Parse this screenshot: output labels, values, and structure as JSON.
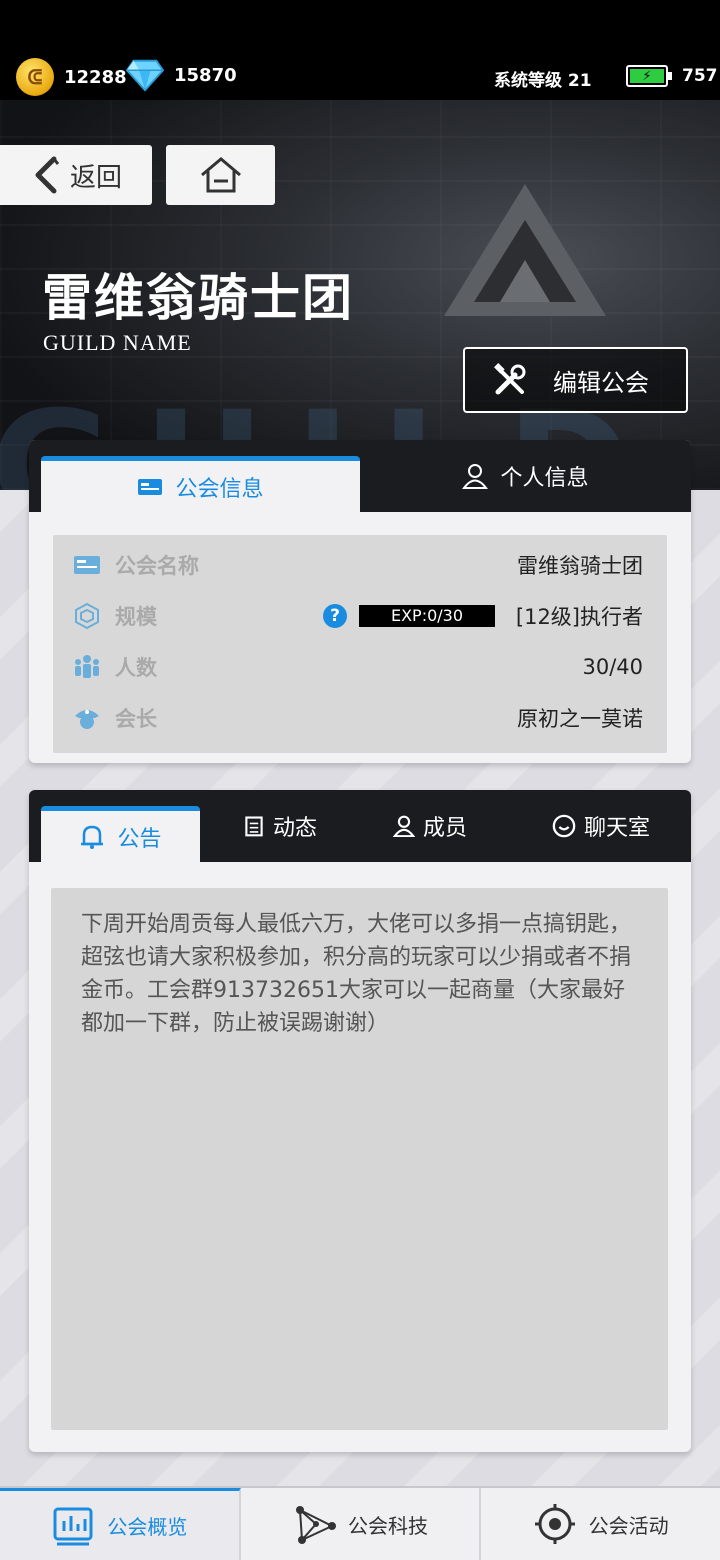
{
  "status_bar": {
    "coins": "12288",
    "gems": "15870",
    "system_level": "系统等级 21",
    "energy": "757"
  },
  "nav": {
    "back_label": "返回"
  },
  "guild": {
    "name": "雷维翁骑士团",
    "subtitle": "GUILD NAME",
    "edit_label": "编辑公会"
  },
  "info_card": {
    "tabs": [
      {
        "label": "公会信息",
        "icon": "id-card-icon"
      },
      {
        "label": "个人信息",
        "icon": "person-icon"
      }
    ],
    "rows": {
      "name": {
        "label": "公会名称",
        "value": "雷维翁骑士团"
      },
      "scale": {
        "label": "规模",
        "help": "?",
        "exp": "EXP:0/30",
        "value": "[12级]执行者"
      },
      "members": {
        "label": "人数",
        "value": "30/40"
      },
      "leader": {
        "label": "会长",
        "value": "原初之一莫诺"
      }
    }
  },
  "notice_card": {
    "tabs": [
      {
        "label": "公告",
        "icon": "bell-icon"
      },
      {
        "label": "动态",
        "icon": "clipboard-icon"
      },
      {
        "label": "成员",
        "icon": "person-icon"
      },
      {
        "label": "聊天室",
        "icon": "chat-icon"
      }
    ],
    "content": "下周开始周贡每人最低六万，大佬可以多捐一点搞钥匙，超弦也请大家积极参加，积分高的玩家可以少捐或者不捐金币。工会群913732651大家可以一起商量（大家最好都加一下群，防止被误踢谢谢）"
  },
  "bottom_nav": [
    {
      "label": "公会概览",
      "icon": "chart-icon",
      "active": true
    },
    {
      "label": "公会科技",
      "icon": "network-icon",
      "active": false
    },
    {
      "label": "公会活动",
      "icon": "target-icon",
      "active": false
    }
  ],
  "colors": {
    "accent": "#1a8ce0",
    "dark": "#1b1c1f",
    "panel": "#d8d8d8"
  }
}
